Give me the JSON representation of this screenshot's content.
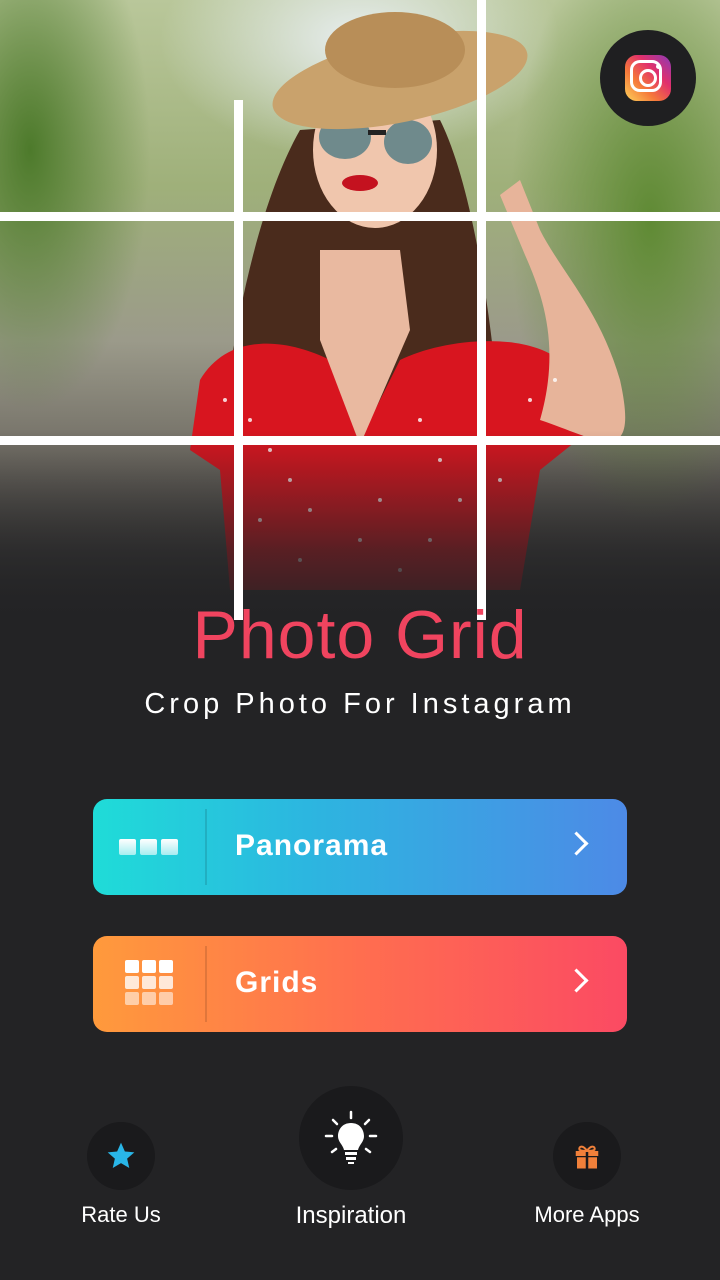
{
  "hero": {
    "instagram_icon": "instagram-logo-icon"
  },
  "title": "Photo Grid",
  "subtitle": "Crop Photo For Instagram",
  "menu": {
    "panorama": {
      "label": "Panorama",
      "icon": "panorama-strip-icon"
    },
    "grids": {
      "label": "Grids",
      "icon": "grid-3x3-icon"
    }
  },
  "bottom_nav": {
    "rate": {
      "label": "Rate Us",
      "icon": "star-icon"
    },
    "inspiration": {
      "label": "Inspiration",
      "icon": "lightbulb-icon"
    },
    "more_apps": {
      "label": "More Apps",
      "icon": "gift-icon"
    }
  },
  "colors": {
    "background": "#232325",
    "title": "#f0445f",
    "panorama_gradient": [
      "#1fdcd8",
      "#4d8ae6"
    ],
    "grids_gradient": [
      "#ff9a3c",
      "#fb4a63"
    ],
    "star": "#29b6e8",
    "gift": "#f0803a"
  }
}
